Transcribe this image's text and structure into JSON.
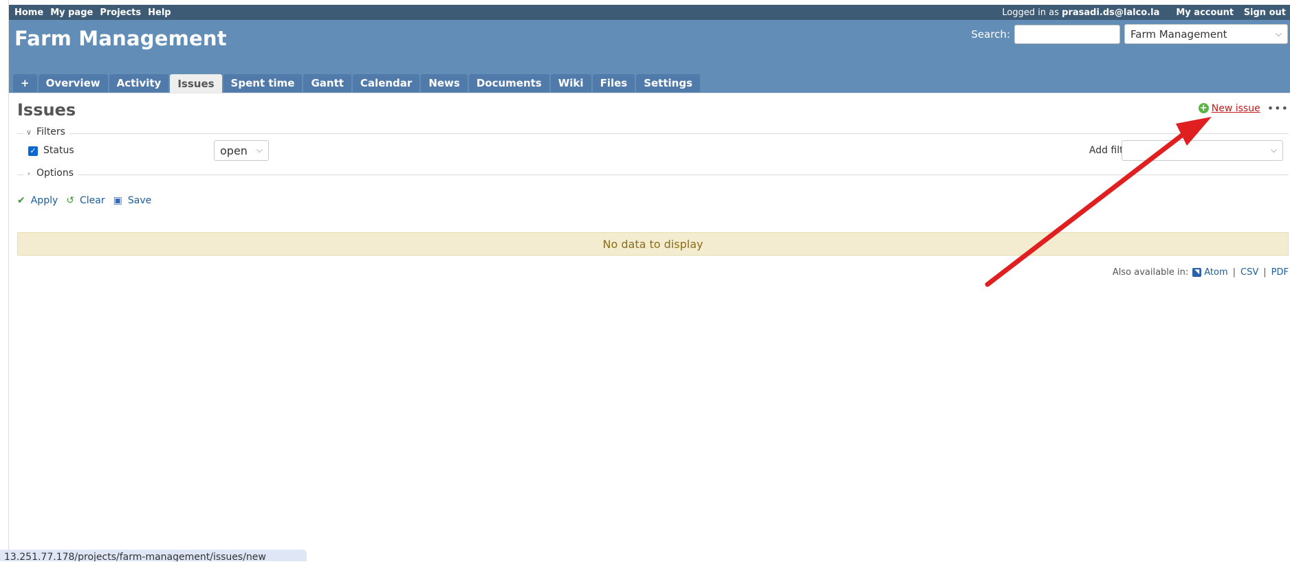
{
  "top_menu": {
    "left_links": [
      "Home",
      "My page",
      "Projects",
      "Help"
    ],
    "logged_in_prefix": "Logged in as",
    "username": "prasadi.ds@lalco.la",
    "right_links": [
      "My account",
      "Sign out"
    ]
  },
  "header": {
    "title": "Farm Management",
    "search_label": "Search:",
    "search_value": "",
    "project_jump": "Farm Management"
  },
  "tabs": [
    {
      "label": "+",
      "selected": false
    },
    {
      "label": "Overview",
      "selected": false
    },
    {
      "label": "Activity",
      "selected": false
    },
    {
      "label": "Issues",
      "selected": true
    },
    {
      "label": "Spent time",
      "selected": false
    },
    {
      "label": "Gantt",
      "selected": false
    },
    {
      "label": "Calendar",
      "selected": false
    },
    {
      "label": "News",
      "selected": false
    },
    {
      "label": "Documents",
      "selected": false
    },
    {
      "label": "Wiki",
      "selected": false
    },
    {
      "label": "Files",
      "selected": false
    },
    {
      "label": "Settings",
      "selected": false
    }
  ],
  "content": {
    "title": "Issues",
    "new_issue": "New issue",
    "more": "•••",
    "filters_legend": "Filters",
    "status_label": "Status",
    "status_checked": true,
    "status_value": "open",
    "add_filter_label": "Add filter",
    "add_filter_value": "",
    "options_legend": "Options",
    "apply": "Apply",
    "clear": "Clear",
    "save": "Save",
    "no_data": "No data to display",
    "also_available": "Also available in:",
    "formats": [
      "Atom",
      "CSV",
      "PDF"
    ]
  },
  "browser_status_url": "13.251.77.178/projects/farm-management/issues/new",
  "colors": {
    "top_menu_bg": "#3e5b76",
    "header_bg": "#628db6",
    "tab_bg": "#507aaa",
    "link": "#1b5c99",
    "new_issue_link": "#c61a1a",
    "annotation_arrow": "#e02020"
  }
}
